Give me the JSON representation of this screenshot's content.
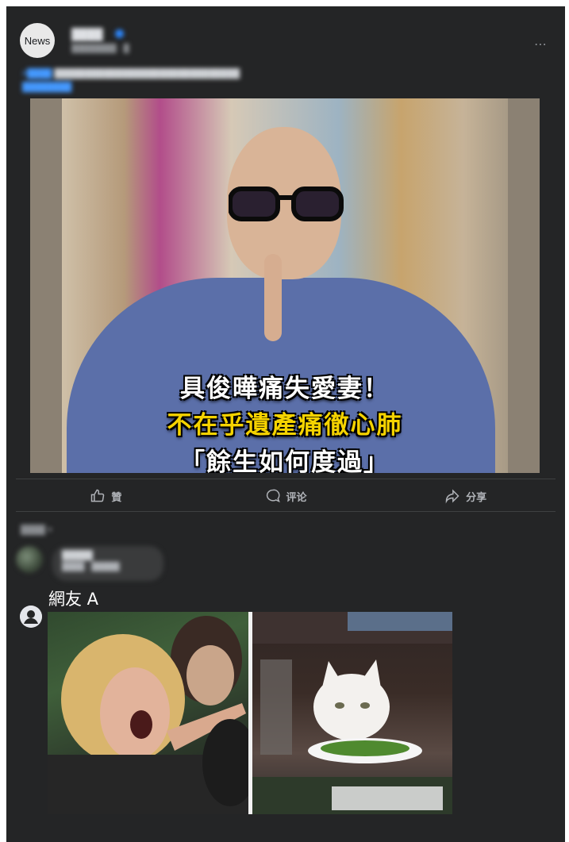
{
  "post": {
    "avatar_text": "News",
    "page_name": "████",
    "meta": "████████ · █",
    "caption_line1_hl": "#████",
    "caption_line1": "██████████████████████████████",
    "caption_line2": "████████",
    "image_text": {
      "line1": "具俊曄痛失愛妻！",
      "line2": "不在乎遺產痛徹心肺",
      "line3": "「餘生如何度過」"
    }
  },
  "actions": {
    "like": "贊",
    "comment": "评论",
    "share": "分享"
  },
  "comments": {
    "sort_label": "████ ▾",
    "first": {
      "name": "█████",
      "text": "████ · █████"
    },
    "second": {
      "name": "網友 A"
    }
  },
  "colors": {
    "card_bg": "#242526",
    "accent": "#2d88ff",
    "image_yellow": "#f5d300"
  }
}
